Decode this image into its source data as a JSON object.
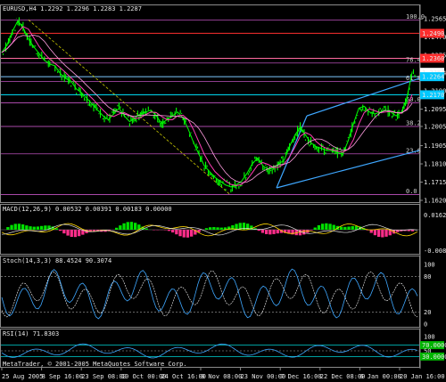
{
  "chart_data": {
    "type": "line",
    "symbol_header": "EURUSD,H4  1.2292 1.2296 1.2283 1.2287",
    "price_axis": {
      "ticks": [
        "1.2565",
        "1.2470",
        "1.2375",
        "1.2284",
        "1.2190",
        "1.2095",
        "1.2005",
        "1.1905",
        "1.1810",
        "1.1715",
        "1.1620"
      ],
      "ylim": [
        1.162,
        1.258
      ],
      "markers": [
        {
          "value": "1.2490",
          "color": "#ff2d2d"
        },
        {
          "value": "1.2360",
          "color": "#ff2d2d"
        },
        {
          "value": "1.2287",
          "color": "#ffffff"
        },
        {
          "value": "1.2264",
          "color": "#00c8ff"
        },
        {
          "value": "1.2170",
          "color": "#00c8ff"
        }
      ]
    },
    "horizontal_lines": [
      {
        "price": 1.249,
        "color": "#ff3030"
      },
      {
        "price": 1.236,
        "color": "#ff6aa0"
      },
      {
        "price": 1.2264,
        "color": "#7ec8ff"
      },
      {
        "price": 1.217,
        "color": "#00e5ff"
      }
    ],
    "fibonacci": {
      "color": "#e060e0",
      "levels": [
        {
          "label": "100.0",
          "price": 1.256
        },
        {
          "label": "76.4",
          "price": 1.2335
        },
        {
          "label": "61.8",
          "price": 1.224
        },
        {
          "label": "50.0",
          "price": 1.2128
        },
        {
          "label": "38.2",
          "price": 1.2005
        },
        {
          "label": "23.6",
          "price": 1.1862
        },
        {
          "label": "0.0",
          "price": 1.165
        }
      ]
    },
    "x_labels": [
      "25 Aug 2005",
      "8 Sep 16:00",
      "23 Sep 08:00",
      "10 Oct 00:00",
      "24 Oct 16:00",
      "8 Nov 08:00",
      "23 Nov 00:00",
      "7 Dec 16:00",
      "22 Dec 08:00",
      "6 Jan 00:00",
      "20 Jan 16:00"
    ],
    "series": [
      {
        "name": "EURUSD,H4",
        "color": "#00ff00",
        "values": [
          1.239,
          1.243,
          1.25,
          1.2555,
          1.252,
          1.246,
          1.242,
          1.2385,
          1.235,
          1.233,
          1.232,
          1.228,
          1.2255,
          1.224,
          1.22,
          1.218,
          1.215,
          1.212,
          1.209,
          1.206,
          1.204,
          1.207,
          1.21,
          1.206,
          1.203,
          1.205,
          1.207,
          1.208,
          1.209,
          1.206,
          1.202,
          1.204,
          1.206,
          1.208,
          1.205,
          1.199,
          1.192,
          1.186,
          1.18,
          1.177,
          1.174,
          1.172,
          1.17,
          1.169,
          1.17,
          1.172,
          1.176,
          1.181,
          1.184,
          1.18,
          1.178,
          1.179,
          1.181,
          1.183,
          1.19,
          1.196,
          1.2,
          1.196,
          1.192,
          1.19,
          1.189,
          1.188,
          1.188,
          1.187,
          1.186,
          1.193,
          1.202,
          1.21,
          1.211,
          1.208,
          1.207,
          1.208,
          1.209,
          1.208,
          1.206,
          1.208,
          1.215,
          1.2287
        ]
      }
    ],
    "indicators": [
      {
        "name": "MACD",
        "header": "MACD(12,26,9) 0.00532 0.00391 0.00183 0.00000",
        "ticks": [
          "0.0162",
          "-0.0081"
        ]
      },
      {
        "name": "Stochastic",
        "header": "Stoch(14,3,3) 88.4524 90.3074",
        "ticks": [
          "100",
          "80",
          "20",
          "0"
        ]
      },
      {
        "name": "RSI",
        "header": "RSI(14) 71.8303",
        "ticks": [
          "100",
          "70.0000",
          "50",
          "30.0000"
        ]
      }
    ],
    "copyright": "MetaTrader, © 2001-2005 MetaQuotes Software Corp."
  }
}
